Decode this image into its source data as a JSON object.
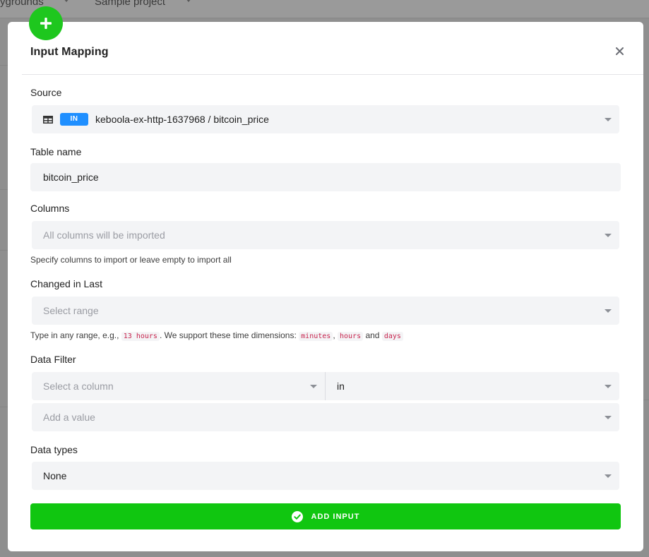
{
  "background": {
    "nav_left": "ygrounds",
    "nav_project": "Sample project"
  },
  "modal": {
    "title": "Input Mapping",
    "source": {
      "label": "Source",
      "badge": "IN",
      "value": "keboola-ex-http-1637968 / bitcoin_price"
    },
    "table_name": {
      "label": "Table name",
      "value": "bitcoin_price"
    },
    "columns": {
      "label": "Columns",
      "placeholder": "All columns will be imported",
      "help": "Specify columns to import or leave empty to import all"
    },
    "changed_in_last": {
      "label": "Changed in Last",
      "placeholder": "Select range",
      "help_prefix": "Type in any range, e.g.,",
      "help_example": "13 hours",
      "help_middle": ". We support these time dimensions:",
      "dim_minutes": "minutes",
      "comma": ",",
      "dim_hours": "hours",
      "and": "and",
      "dim_days": "days"
    },
    "data_filter": {
      "label": "Data Filter",
      "column_placeholder": "Select a column",
      "operator_value": "in",
      "value_placeholder": "Add a value"
    },
    "data_types": {
      "label": "Data types",
      "value": "None"
    },
    "submit_label": "ADD INPUT"
  },
  "colors": {
    "accent_green": "#10c610",
    "badge_blue": "#1f8fff"
  },
  "icons": {
    "add_badge": "plus-icon",
    "close": "close-icon",
    "source_type": "table-icon",
    "submit": "check-circle-icon"
  }
}
